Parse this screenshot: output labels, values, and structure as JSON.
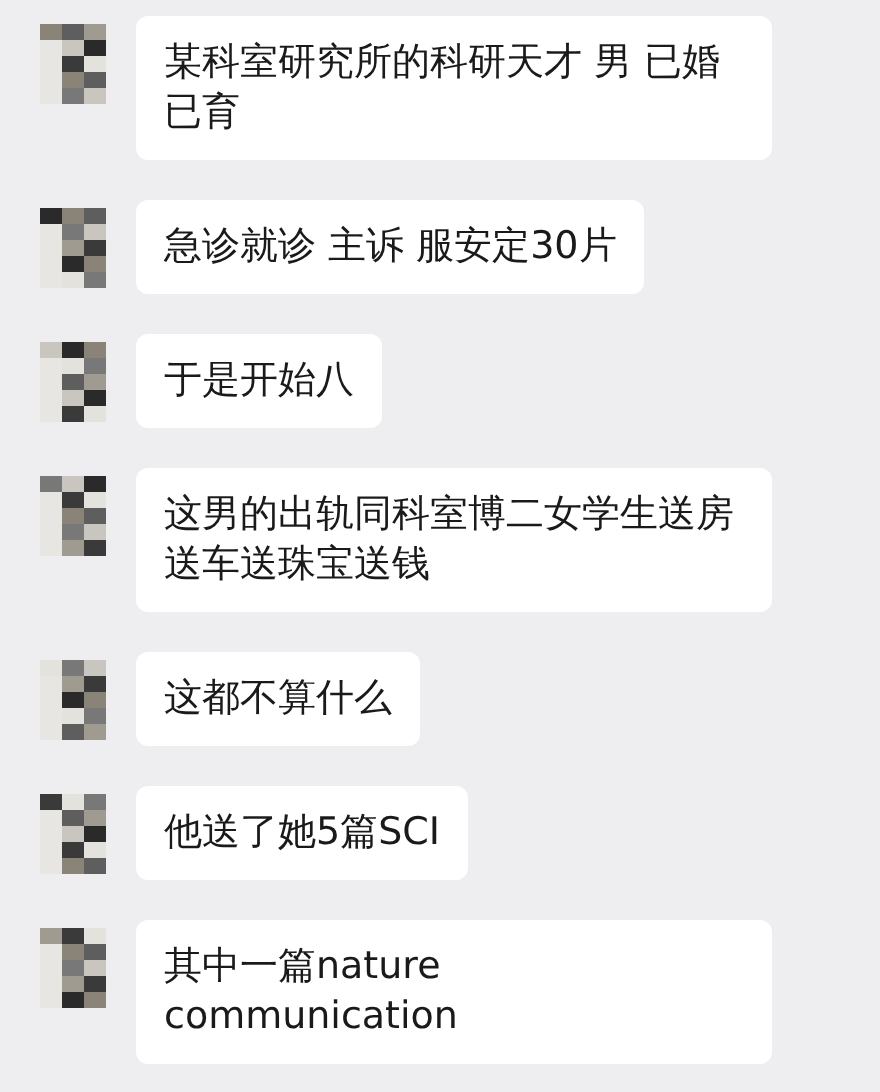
{
  "messages": [
    {
      "text": "某科室研究所的科研天才 男 已婚已育"
    },
    {
      "text": "急诊就诊 主诉 服安定30片"
    },
    {
      "text": "于是开始八"
    },
    {
      "text": "这男的出轨同科室博二女学生送房送车送珠宝送钱"
    },
    {
      "text": "这都不算什么"
    },
    {
      "text": "他送了她5篇SCI"
    },
    {
      "text": "其中一篇nature communication"
    }
  ]
}
